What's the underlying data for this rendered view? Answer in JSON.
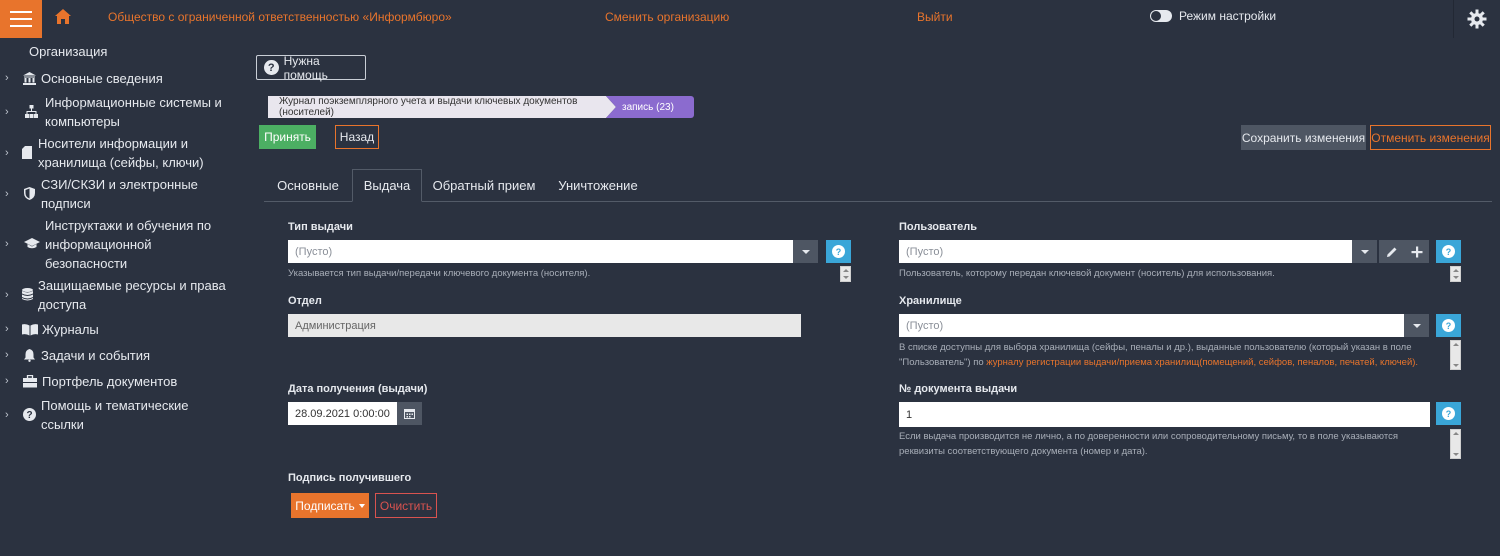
{
  "topbar": {
    "org_name": "Общество с ограниченной ответственностью «Информбюро»",
    "change_org": "Сменить организацию",
    "logout": "Выйти",
    "setup_mode": "Режим настройки"
  },
  "sidebar": {
    "title": "Организация",
    "items": [
      {
        "label_line1": "Основные сведения",
        "label_line2": "",
        "label_line3": "",
        "icon": "bank-icon"
      },
      {
        "label_line1": "Информационные системы и",
        "label_line2": "компьютеры",
        "label_line3": "",
        "icon": "network-icon"
      },
      {
        "label_line1": "Носители информации и",
        "label_line2": "хранилища (сейфы, ключи)",
        "label_line3": "",
        "icon": "sd-card-icon"
      },
      {
        "label_line1": "СЗИ/СКЗИ и электронные",
        "label_line2": "подписи",
        "label_line3": "",
        "icon": "shield-icon"
      },
      {
        "label_line1": "Инструктажи и обучения по",
        "label_line2": "информационной",
        "label_line3": "безопасности",
        "icon": "graduation-cap-icon"
      },
      {
        "label_line1": "Защищаемые ресурсы и права",
        "label_line2": "доступа",
        "label_line3": "",
        "icon": "database-icon"
      },
      {
        "label_line1": "Журналы",
        "label_line2": "",
        "label_line3": "",
        "icon": "book-icon"
      },
      {
        "label_line1": "Задачи и события",
        "label_line2": "",
        "label_line3": "",
        "icon": "bell-icon"
      },
      {
        "label_line1": "Портфель документов",
        "label_line2": "",
        "label_line3": "",
        "icon": "briefcase-icon"
      },
      {
        "label_line1": "Помощь и тематические",
        "label_line2": "ссылки",
        "label_line3": "",
        "icon": "question-circle-icon"
      }
    ]
  },
  "main": {
    "help_button": "Нужна помощь",
    "breadcrumb": {
      "journal": "Журнал поэкземплярного учета и выдачи ключевых документов (носителей)",
      "record": "запись (23)"
    },
    "buttons": {
      "accept": "Принять",
      "back": "Назад",
      "save": "Сохранить изменения",
      "cancel": "Отменить изменения"
    },
    "tabs": [
      {
        "label": "Основные"
      },
      {
        "label": "Выдача"
      },
      {
        "label": "Обратный прием"
      },
      {
        "label": "Уничтожение"
      }
    ],
    "form": {
      "issue_type": {
        "label": "Тип выдачи",
        "value": "(Пусто)",
        "hint": "Указывается тип выдачи/передачи ключевого документа (носителя)."
      },
      "department": {
        "label": "Отдел",
        "value": "Администрация"
      },
      "receive_date": {
        "label": "Дата получения (выдачи)",
        "value": "28.09.2021 0:00:00"
      },
      "signature": {
        "label": "Подпись получившего",
        "sign_button": "Подписать",
        "clear_button": "Очистить"
      },
      "user": {
        "label": "Пользователь",
        "value": "(Пусто)",
        "hint": "Пользователь, которому передан ключевой документ (носитель) для использования."
      },
      "storage": {
        "label": "Хранилище",
        "value": "(Пусто)",
        "hint_line1": "В списке доступны для выбора хранилища (сейфы, пеналы и др.), выданные пользователю (который указан в поле",
        "hint_line2_prefix": "\"Пользователь\") по ",
        "hint_link": "журналу регистрации выдачи/приема хранилищ(помещений, сейфов, пеналов, печатей, ключей)."
      },
      "doc_number": {
        "label": "№ документа выдачи",
        "value": "1",
        "hint_line1": "Если выдача производится не лично, а по доверенности или сопроводительному письму, то в поле указываются",
        "hint_line2": "реквизиты соответствующего документа (номер и дата)."
      }
    }
  },
  "colors": {
    "background": "#2b3240",
    "accent": "#e8742c",
    "success": "#4caf63",
    "info": "#3aa6d8",
    "record_badge": "#8b6bcf"
  }
}
